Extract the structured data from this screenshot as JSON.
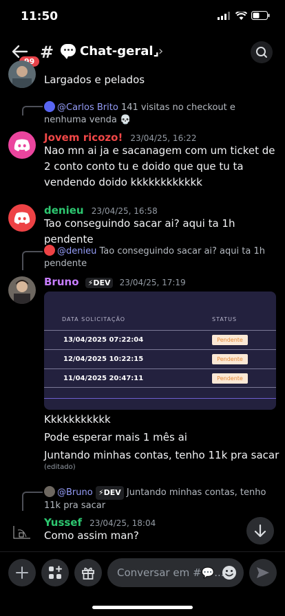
{
  "status_bar": {
    "time": "11:50"
  },
  "header": {
    "badge": "99",
    "hash": "#",
    "title": "Chat-geral⌟",
    "chevron": "›"
  },
  "messages": {
    "m0": {
      "body": "Largados e pelados"
    },
    "m1": {
      "reply_name": "@Carlos Brito",
      "reply_text": "141 visitas no checkout e nenhuma venda 💀",
      "author": "Jovem ricozo!",
      "timestamp": "23/04/25, 16:22",
      "body": "Nao mn ai ja e sacanagem com um ticket de 2 conto conto tu e doido que que tu ta vendendo doido kkkkkkkkkkkk",
      "author_color": "#f04747"
    },
    "m2": {
      "author": "denieu",
      "timestamp": "23/04/25, 16:58",
      "body": "Tao conseguindo sacar ai? aqui ta 1h pendente",
      "author_color": "#2dc770"
    },
    "m3": {
      "reply_name": "@denieu",
      "reply_text": "Tao conseguindo sacar ai? aqui ta 1h pendente",
      "author": "Bruno",
      "tag": "⚡DEV",
      "timestamp": "23/04/25, 17:19",
      "author_color": "#c77dff",
      "card": {
        "col_date": "DATA SOLICITAÇÃO",
        "col_status": "STATUS",
        "rows": [
          {
            "date": "13/04/2025 07:22:04",
            "status": "Pendente"
          },
          {
            "date": "12/04/2025 10:22:15",
            "status": "Pendente"
          },
          {
            "date": "11/04/2025 20:47:11",
            "status": "Pendente"
          }
        ]
      },
      "follow1": "Kkkkkkkkkkk",
      "follow2": "Pode esperar mais 1 mês ai",
      "follow3": "Juntando minhas contas, tenho 11k pra sacar",
      "edited": "(editado)"
    },
    "m4": {
      "reply_name": "@Bruno",
      "reply_tag": "⚡DEV",
      "reply_text": "Juntando minhas contas, tenho 11k pra sacar",
      "author": "Yussef",
      "timestamp": "23/04/25, 18:04",
      "body": "Como assim man?",
      "author_color": "#2dc770"
    }
  },
  "composer": {
    "placeholder": "Conversar em #💬..."
  },
  "colors": {
    "discord_pink": "#eb459e",
    "discord_red": "#ed4245",
    "link_blue": "#949cf7"
  }
}
